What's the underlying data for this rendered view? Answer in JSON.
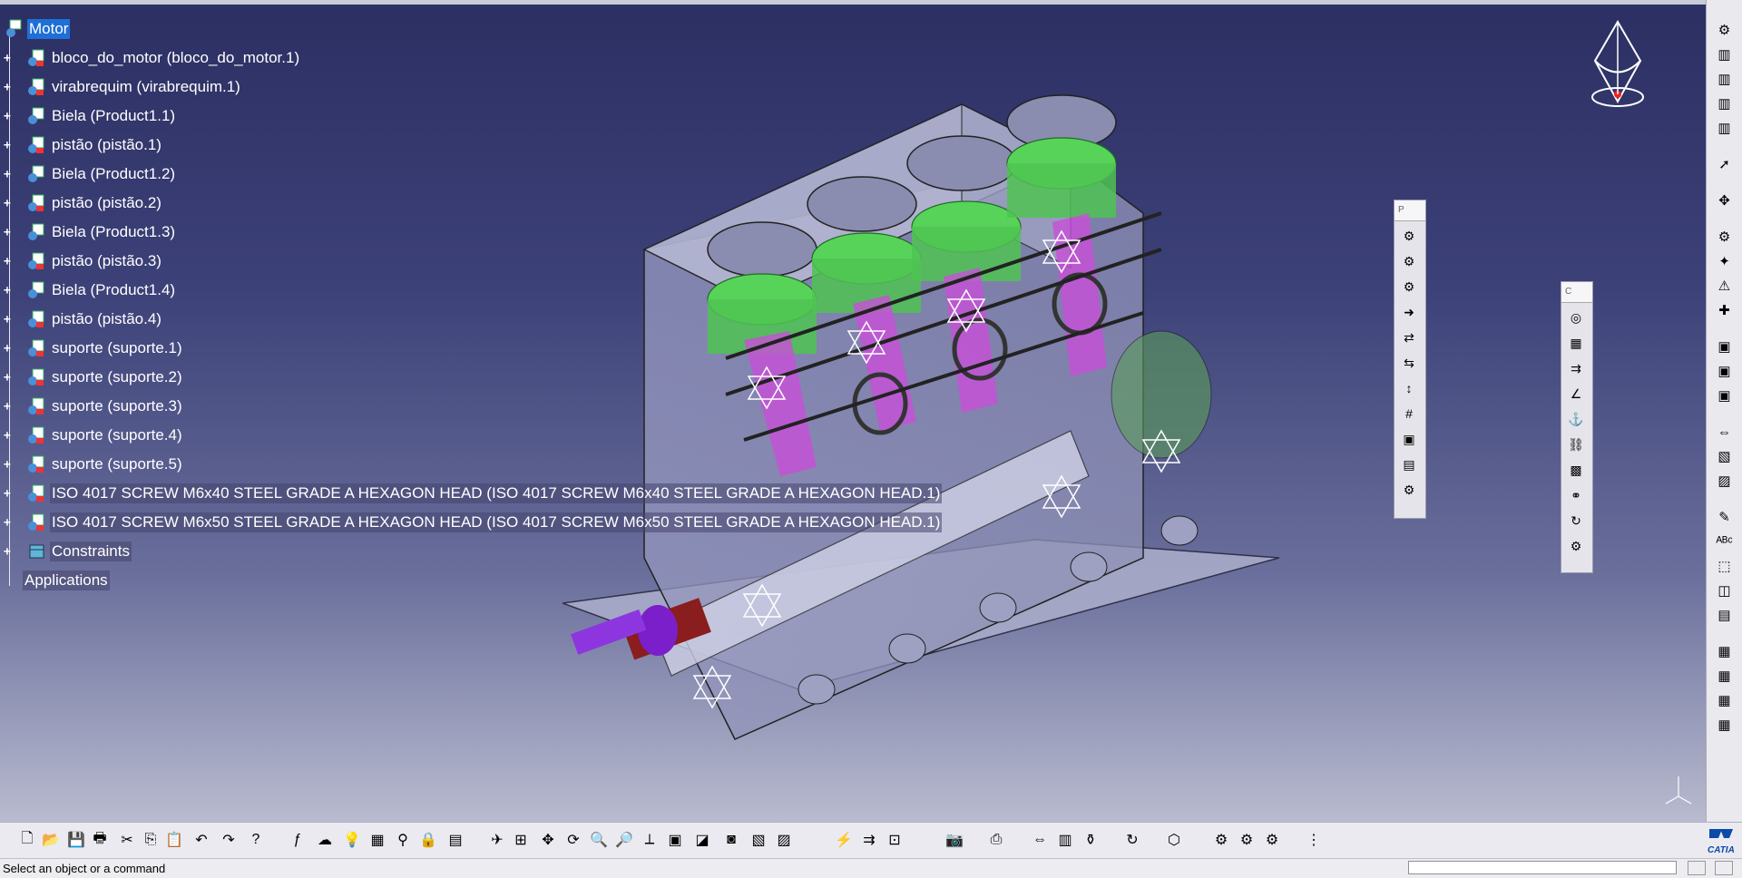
{
  "tree": {
    "root_label": "Motor",
    "items": [
      {
        "label": "bloco_do_motor (bloco_do_motor.1)"
      },
      {
        "label": "virabrequim (virabrequim.1)"
      },
      {
        "label": "Biela (Product1.1)"
      },
      {
        "label": "pistão (pistão.1)"
      },
      {
        "label": "Biela (Product1.2)"
      },
      {
        "label": "pistão (pistão.2)"
      },
      {
        "label": "Biela (Product1.3)"
      },
      {
        "label": "pistão (pistão.3)"
      },
      {
        "label": "Biela (Product1.4)"
      },
      {
        "label": "pistão (pistão.4)"
      },
      {
        "label": "suporte (suporte.1)"
      },
      {
        "label": "suporte (suporte.2)"
      },
      {
        "label": "suporte (suporte.3)"
      },
      {
        "label": "suporte (suporte.4)"
      },
      {
        "label": "suporte (suporte.5)"
      },
      {
        "label": "ISO 4017 SCREW M6x40 STEEL GRADE A HEXAGON HEAD (ISO 4017 SCREW M6x40 STEEL GRADE A HEXAGON HEAD.1)"
      },
      {
        "label": "ISO 4017 SCREW M6x50 STEEL GRADE A HEXAGON HEAD (ISO 4017 SCREW M6x50 STEEL GRADE A HEXAGON HEAD.1)"
      }
    ],
    "constraints_label": "Constraints",
    "applications_label": "Applications"
  },
  "floating_toolbars": [
    {
      "title": "P",
      "icons": [
        "product-icon",
        "component-icon",
        "part-icon",
        "existing-component-icon",
        "replace-component-icon",
        "graph-tree-icon",
        "reorder-icon",
        "numbering-icon",
        "selective-load-icon",
        "manage-representations-icon",
        "multi-instantiation-icon"
      ]
    },
    {
      "title": "C",
      "icons": [
        "coincidence-constraint-icon",
        "contact-constraint-icon",
        "offset-constraint-icon",
        "angle-constraint-icon",
        "fix-component-icon",
        "fix-together-icon",
        "quick-constraint-icon",
        "flexible-rigid-icon",
        "change-constraint-icon",
        "reuse-pattern-icon"
      ]
    }
  ],
  "status": {
    "message": "Select an object or a command",
    "power_input_value": ""
  },
  "colors": {
    "viewport_top": "#2c2f62",
    "viewport_bottom": "#b9bbcf",
    "selection": "#1e6fd6",
    "piston": "#58d35a",
    "rod": "#c84fd8"
  },
  "logo_text": "CATIA"
}
